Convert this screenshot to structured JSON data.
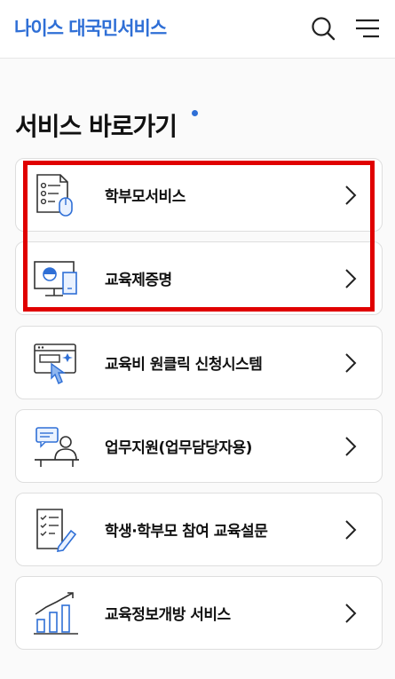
{
  "header": {
    "logo": "나이스 대국민서비스",
    "search_icon": "search-icon",
    "menu_icon": "hamburger-menu-icon"
  },
  "section": {
    "title": "서비스 바로가기",
    "dot_color": "#2f6fd6"
  },
  "services": [
    {
      "label": "학부모서비스",
      "icon": "parent-service-icon"
    },
    {
      "label": "교육제증명",
      "icon": "certificate-monitor-icon"
    },
    {
      "label": "교육비 원클릭 신청시스템",
      "icon": "one-click-apply-icon"
    },
    {
      "label": "업무지원(업무담당자용)",
      "icon": "work-support-icon"
    },
    {
      "label": "학생·학부모 참여 교육설문",
      "icon": "survey-icon"
    },
    {
      "label": "교육정보개방 서비스",
      "icon": "info-open-chart-icon"
    }
  ],
  "colors": {
    "accent_blue": "#2f6fd6",
    "highlight_red": "#e00000"
  }
}
